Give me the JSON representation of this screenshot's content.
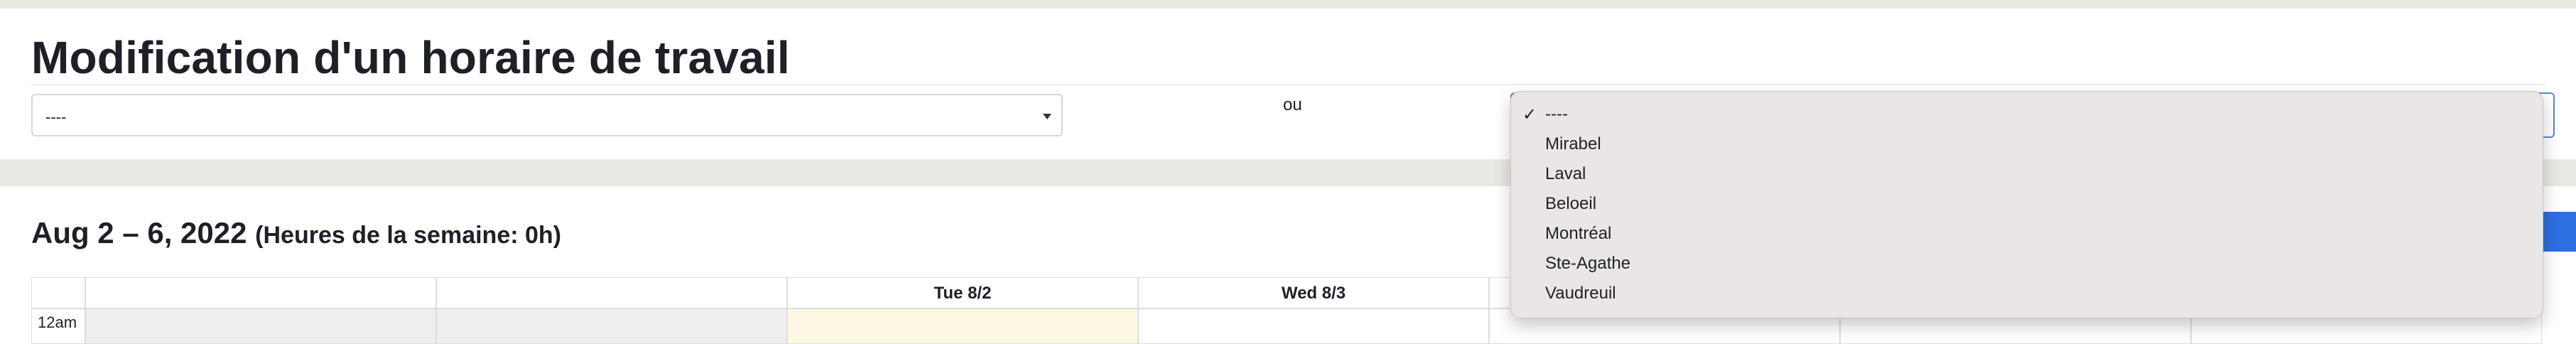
{
  "page_title": "Modification d'un horaire de travail",
  "employee_select": {
    "value": "----"
  },
  "or_label": "ou",
  "location_dropdown": {
    "selected": "----",
    "options": [
      "----",
      "Mirabel",
      "Laval",
      "Beloeil",
      "Montréal",
      "Ste-Agathe",
      "Vaudreuil"
    ]
  },
  "calendar": {
    "range_title": "Aug 2 – 6, 2022",
    "week_hours": "(Heures de la semaine: 0h)",
    "day_headers": [
      "",
      "",
      "Tue 8/2",
      "Wed 8/3",
      "",
      "",
      ""
    ],
    "time_label": "12am"
  },
  "colors": {
    "today_cell": "#fdf8e1",
    "disabled_cell": "#eeeeee",
    "accent_button": "#2c6fe0"
  }
}
